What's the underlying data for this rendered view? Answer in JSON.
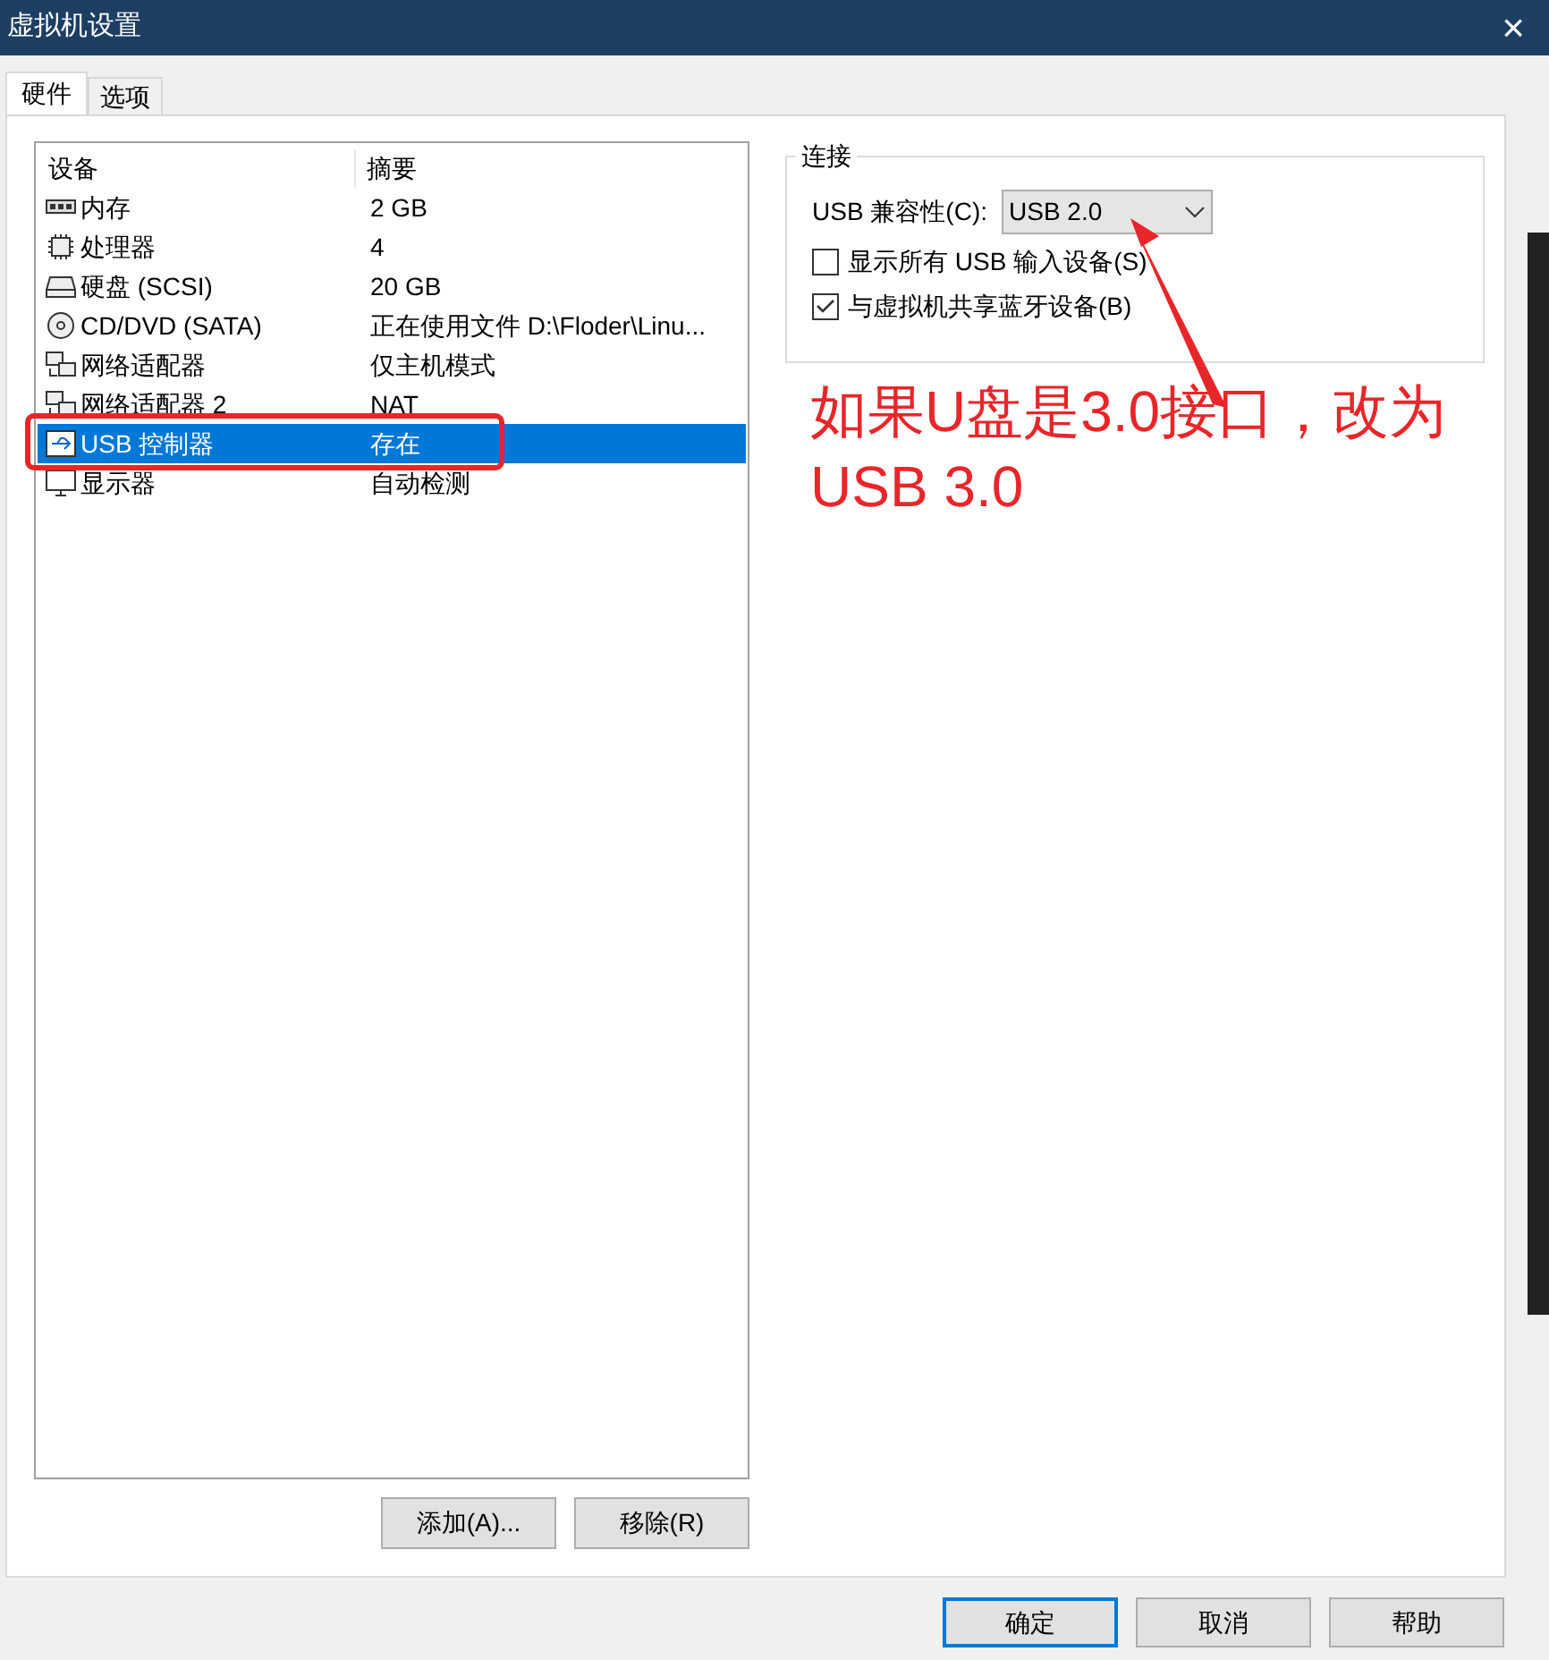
{
  "window": {
    "title": "虚拟机设置",
    "close": "×"
  },
  "tabs": [
    {
      "label": "硬件",
      "selected": true
    },
    {
      "label": "选项",
      "selected": false
    }
  ],
  "devices": {
    "columns": [
      "设备",
      "摘要"
    ],
    "rows": [
      {
        "kind": "memory",
        "name": "内存",
        "summary": "2 GB",
        "selected": false
      },
      {
        "kind": "cpu",
        "name": "处理器",
        "summary": "4",
        "selected": false
      },
      {
        "kind": "disk",
        "name": "硬盘 (SCSI)",
        "summary": "20 GB",
        "selected": false
      },
      {
        "kind": "cd",
        "name": "CD/DVD (SATA)",
        "summary": "正在使用文件 D:\\Floder\\Linu...",
        "selected": false
      },
      {
        "kind": "network",
        "name": "网络适配器",
        "summary": "仅主机模式",
        "selected": false
      },
      {
        "kind": "network",
        "name": "网络适配器 2",
        "summary": "NAT",
        "selected": false
      },
      {
        "kind": "usb",
        "name": "USB 控制器",
        "summary": "存在",
        "selected": true
      },
      {
        "kind": "display",
        "name": "显示器",
        "summary": "自动检测",
        "selected": false
      }
    ]
  },
  "list_buttons": [
    "添加(A)...",
    "移除(R)"
  ],
  "connection": {
    "title": "连接",
    "compatibility_label": "USB 兼容性(C):",
    "compatibility_value": "USB 2.0",
    "options": [
      {
        "label": "显示所有 USB 输入设备(S)",
        "checked": false
      },
      {
        "label": "与虚拟机共享蓝牙设备(B)",
        "checked": true
      }
    ]
  },
  "annotation": {
    "text": "如果U盘是3.0接口，改为USB 3.0"
  },
  "dialog_buttons": [
    {
      "label": "确定",
      "default": true
    },
    {
      "label": "取消",
      "default": false
    },
    {
      "label": "帮助",
      "default": false
    }
  ]
}
